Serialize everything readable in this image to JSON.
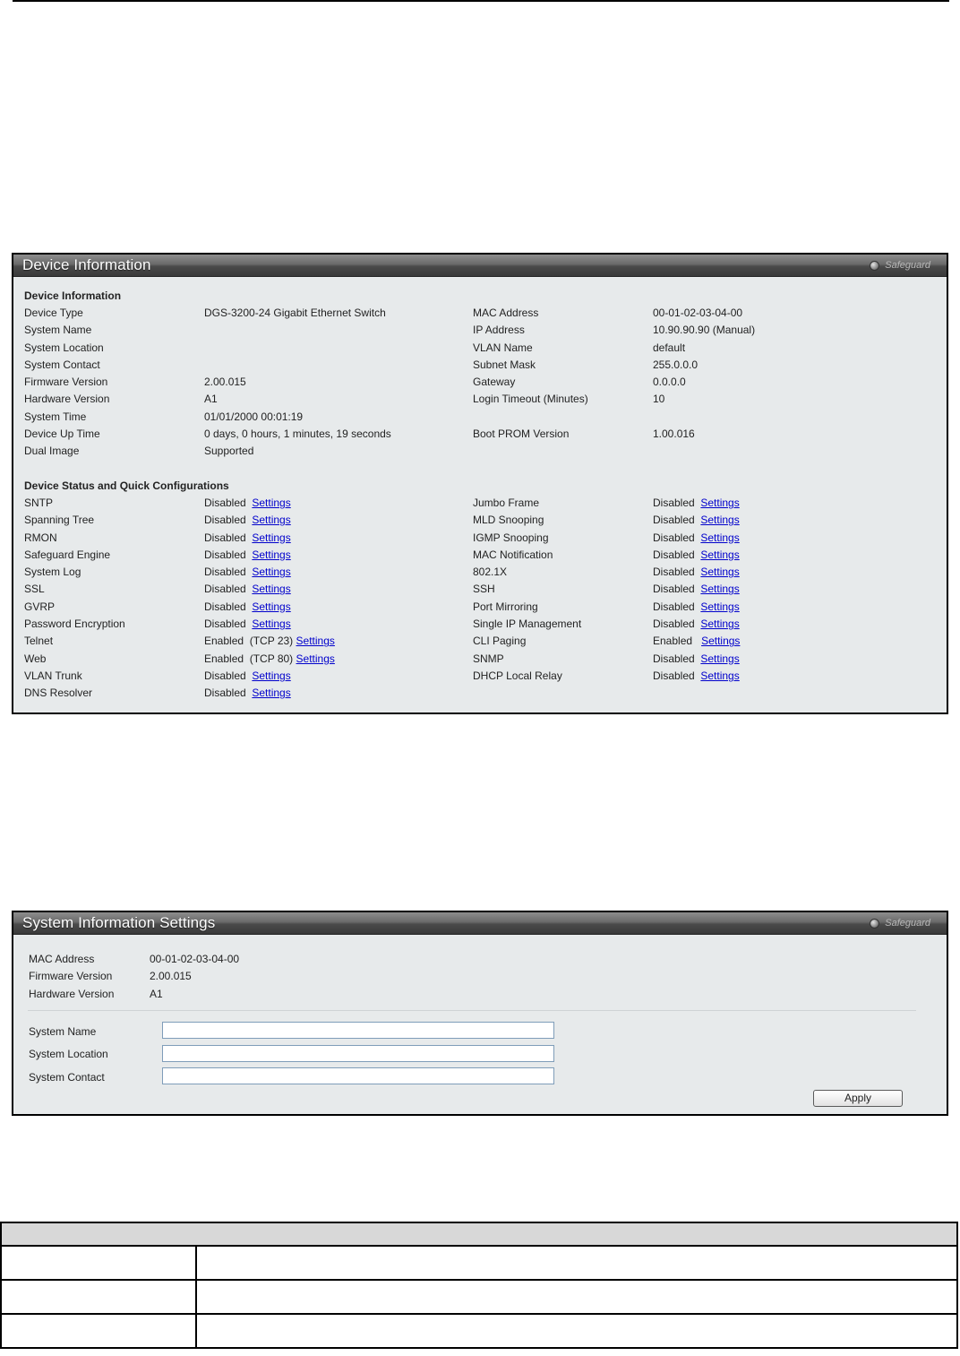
{
  "device_panel": {
    "title": "Device Information",
    "safeguard": "Safeguard",
    "info_heading": "Device Information",
    "left_rows": [
      {
        "label": "Device Type",
        "value": "DGS-3200-24 Gigabit Ethernet Switch"
      },
      {
        "label": "System Name",
        "value": ""
      },
      {
        "label": "System Location",
        "value": ""
      },
      {
        "label": "System Contact",
        "value": ""
      },
      {
        "label": "Firmware Version",
        "value": "2.00.015"
      },
      {
        "label": "Hardware Version",
        "value": "A1"
      },
      {
        "label": "System Time",
        "value": "01/01/2000 00:01:19"
      },
      {
        "label": "Device Up Time",
        "value": "0 days, 0 hours, 1 minutes, 19 seconds"
      },
      {
        "label": "Dual Image",
        "value": "Supported"
      }
    ],
    "right_rows": [
      {
        "label": "MAC Address",
        "value": "00-01-02-03-04-00"
      },
      {
        "label": "IP Address",
        "value": "10.90.90.90 (Manual)"
      },
      {
        "label": "VLAN Name",
        "value": "default"
      },
      {
        "label": "Subnet Mask",
        "value": "255.0.0.0"
      },
      {
        "label": "Gateway",
        "value": "0.0.0.0"
      },
      {
        "label": "Login Timeout (Minutes)",
        "value": "10"
      },
      {
        "label": "",
        "value": ""
      },
      {
        "label": "Boot PROM Version",
        "value": "1.00.016"
      }
    ],
    "status_heading": "Device Status and Quick Configurations",
    "status_left": [
      {
        "label": "SNTP",
        "status": "Disabled",
        "extra": "",
        "link": "Settings"
      },
      {
        "label": "Spanning Tree",
        "status": "Disabled",
        "extra": "",
        "link": "Settings"
      },
      {
        "label": "RMON",
        "status": "Disabled",
        "extra": "",
        "link": "Settings"
      },
      {
        "label": "Safeguard Engine",
        "status": "Disabled",
        "extra": "",
        "link": "Settings"
      },
      {
        "label": "System Log",
        "status": "Disabled",
        "extra": "",
        "link": "Settings"
      },
      {
        "label": "SSL",
        "status": "Disabled",
        "extra": "",
        "link": "Settings"
      },
      {
        "label": "GVRP",
        "status": "Disabled",
        "extra": "",
        "link": "Settings"
      },
      {
        "label": "Password Encryption",
        "status": "Disabled",
        "extra": "",
        "link": "Settings"
      },
      {
        "label": "Telnet",
        "status": "Enabled",
        "extra": "(TCP 23)",
        "link": "Settings"
      },
      {
        "label": "Web",
        "status": "Enabled",
        "extra": "(TCP 80)",
        "link": "Settings"
      },
      {
        "label": "VLAN Trunk",
        "status": "Disabled",
        "extra": "",
        "link": "Settings"
      },
      {
        "label": "DNS Resolver",
        "status": "Disabled",
        "extra": "",
        "link": "Settings"
      }
    ],
    "status_right": [
      {
        "label": "Jumbo Frame",
        "status": "Disabled",
        "link": "Settings"
      },
      {
        "label": "MLD Snooping",
        "status": "Disabled",
        "link": "Settings"
      },
      {
        "label": "IGMP Snooping",
        "status": "Disabled",
        "link": "Settings"
      },
      {
        "label": "MAC Notification",
        "status": "Disabled",
        "link": "Settings"
      },
      {
        "label": "802.1X",
        "status": "Disabled",
        "link": "Settings"
      },
      {
        "label": "SSH",
        "status": "Disabled",
        "link": "Settings"
      },
      {
        "label": "Port Mirroring",
        "status": "Disabled",
        "link": "Settings"
      },
      {
        "label": "Single IP Management",
        "status": "Disabled",
        "link": "Settings"
      },
      {
        "label": "CLI Paging",
        "status": "Enabled",
        "link": "Settings"
      },
      {
        "label": "SNMP",
        "status": "Disabled",
        "link": "Settings"
      },
      {
        "label": "DHCP Local Relay",
        "status": "Disabled",
        "link": "Settings"
      }
    ]
  },
  "sysinfo_panel": {
    "title": "System Information Settings",
    "safeguard": "Safeguard",
    "static_rows": [
      {
        "label": "MAC Address",
        "value": "00-01-02-03-04-00"
      },
      {
        "label": "Firmware Version",
        "value": "2.00.015"
      },
      {
        "label": "Hardware Version",
        "value": "A1"
      }
    ],
    "fields": [
      {
        "label": "System Name",
        "value": ""
      },
      {
        "label": "System Location",
        "value": ""
      },
      {
        "label": "System Contact",
        "value": ""
      }
    ],
    "apply_label": "Apply"
  },
  "description_table": {
    "header": "",
    "rows": [
      {
        "param": "",
        "desc": ""
      },
      {
        "param": "",
        "desc": ""
      },
      {
        "param": "",
        "desc": ""
      }
    ]
  },
  "colors": {
    "panel_bg": "#e7eaeb",
    "link": "#0000cc",
    "header_dark": "#3a3a3a"
  }
}
